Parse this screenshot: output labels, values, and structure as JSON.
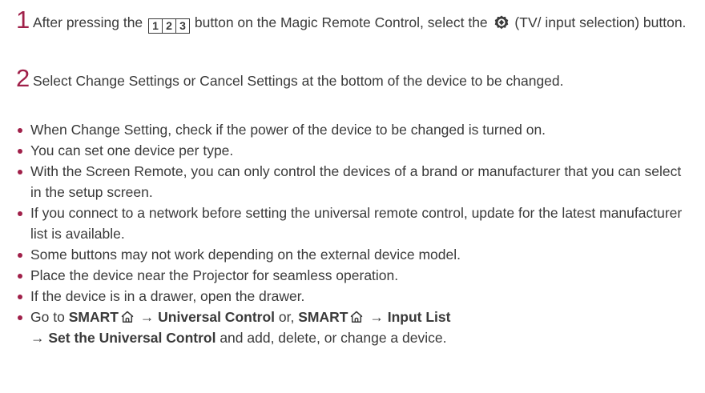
{
  "steps": [
    {
      "number": "1",
      "text_before_button": "After pressing the",
      "button_digits": [
        "1",
        "2",
        "3"
      ],
      "text_middle": "button on the Magic Remote Control, select the",
      "text_after_icon": "(TV/ input selection) button."
    },
    {
      "number": "2",
      "text": "Select Change Settings or Cancel Settings at the bottom of the device to be changed."
    }
  ],
  "bullets": [
    "When Change Setting, check if the power of the device to be changed is turned on.",
    "You can set one device per type.",
    "With the Screen Remote, you can only control the devices of a brand or manufacturer that you can select in the setup screen.",
    "If you connect to a network before setting the universal remote control, update for the latest manufacturer list is available.",
    "Some buttons may not work depending on the external device model.",
    "Place the device near the Projector for seamless operation.",
    "If the device is in a drawer, open the drawer."
  ],
  "last_bullet": {
    "go_to": "Go to",
    "smart1": "SMART",
    "arrow1": "→",
    "universal_control": "Universal Control",
    "or": "or,",
    "smart2": "SMART",
    "arrow2": "→",
    "input_list": "Input List",
    "arrow3": "→",
    "set_universal": "Set the Universal Control",
    "tail": "and add, delete, or change a device."
  },
  "colors": {
    "accent": "#a02049",
    "text": "#3a3a3a"
  },
  "icons": [
    "number-buttons-icon",
    "tv-input-gear-icon",
    "home-icon"
  ]
}
